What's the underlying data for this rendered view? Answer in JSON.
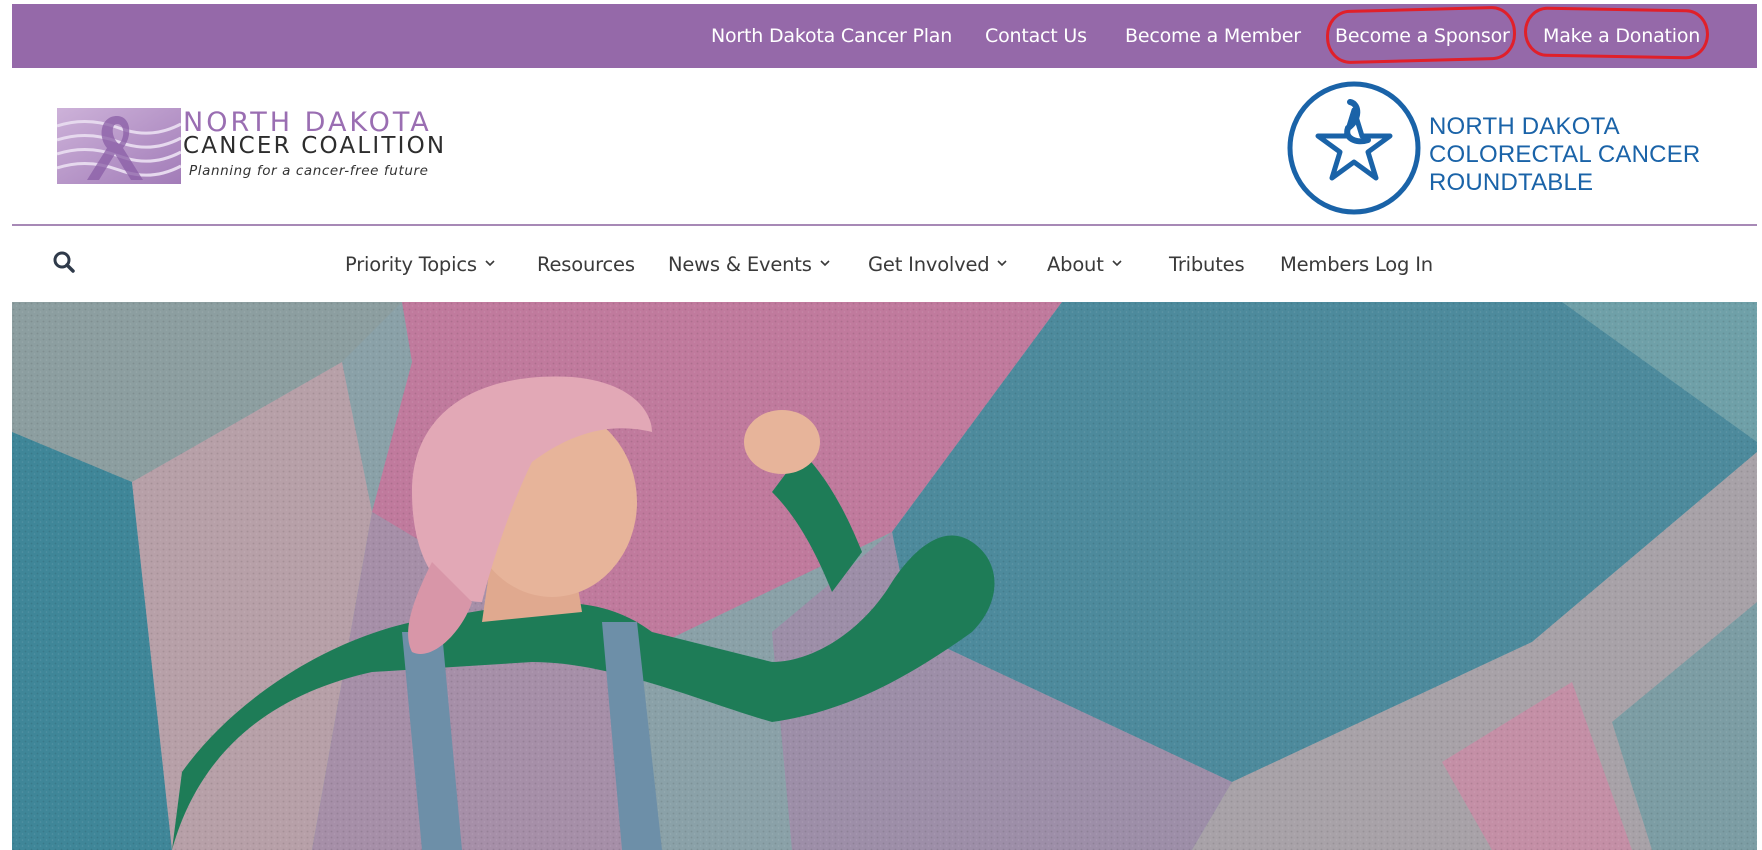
{
  "top_bar": {
    "links": [
      {
        "label": "North Dakota Cancer Plan"
      },
      {
        "label": "Contact Us"
      },
      {
        "label": "Become a Member"
      },
      {
        "label": "Become a Sponsor",
        "highlighted": true
      },
      {
        "label": "Make a Donation",
        "highlighted": true
      }
    ],
    "background": "#9569a9",
    "annotation_color": "#e0202a"
  },
  "header": {
    "coalition_logo": {
      "line1": "NORTH DAKOTA",
      "line2": "CANCER COALITION",
      "tagline": "Planning for a cancer-free future",
      "icon": "awareness-ribbon-icon"
    },
    "roundtable_logo": {
      "line1": "NORTH DAKOTA",
      "line2": "COLORECTAL CANCER",
      "line3": "ROUNDTABLE",
      "icon": "star-ribbon-icon",
      "color": "#1a63a8"
    }
  },
  "nav": {
    "search_icon": "search-icon",
    "items": [
      {
        "label": "Priority Topics",
        "has_dropdown": true
      },
      {
        "label": "Resources",
        "has_dropdown": false
      },
      {
        "label": "News & Events",
        "has_dropdown": true
      },
      {
        "label": "Get Involved",
        "has_dropdown": true
      },
      {
        "label": "About",
        "has_dropdown": true
      },
      {
        "label": "Tributes",
        "has_dropdown": false
      },
      {
        "label": "Members Log In",
        "has_dropdown": false
      }
    ]
  },
  "hero": {
    "image": "smiling-woman-flexing-arm-in-front-of-geometric-mural"
  }
}
